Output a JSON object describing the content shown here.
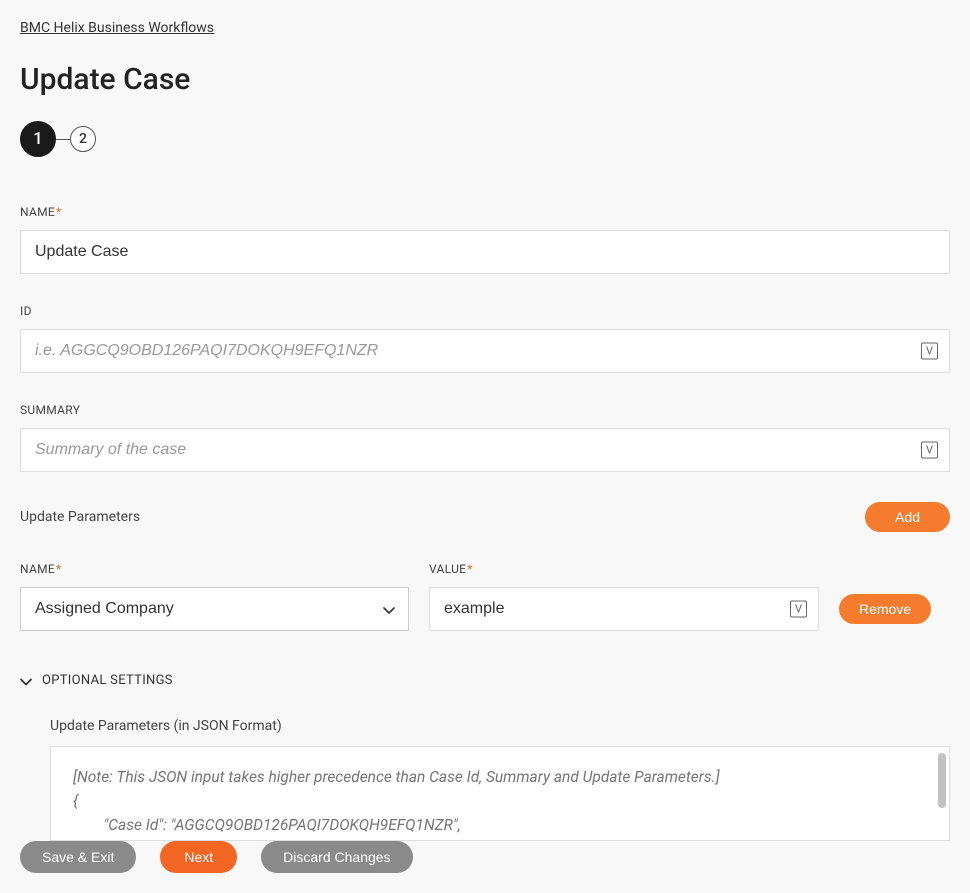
{
  "breadcrumb": "BMC Helix Business Workflows",
  "page_title": "Update Case",
  "stepper": {
    "steps": [
      "1",
      "2"
    ],
    "active": 0
  },
  "fields": {
    "name": {
      "label": "NAME",
      "required": true,
      "value": "Update Case"
    },
    "id": {
      "label": "ID",
      "required": false,
      "placeholder": "i.e. AGGCQ9OBD126PAQI7DOKQH9EFQ1NZR",
      "value": ""
    },
    "summary": {
      "label": "SUMMARY",
      "required": false,
      "placeholder": "Summary of the case",
      "value": ""
    }
  },
  "update_params": {
    "title": "Update Parameters",
    "add_label": "Add",
    "remove_label": "Remove",
    "row": {
      "name_label": "NAME",
      "name_value": "Assigned Company",
      "value_label": "VALUE",
      "value_value": "example"
    }
  },
  "optional": {
    "title": "OPTIONAL SETTINGS",
    "json_label": "Update Parameters (in JSON Format)",
    "json_placeholder": "[Note: This JSON input takes higher precedence than Case Id, Summary and Update Parameters.]\n{\n        \"Case Id\": \"AGGCQ9OBD126PAQI7DOKQH9EFQ1NZR\","
  },
  "footer": {
    "save": "Save & Exit",
    "next": "Next",
    "discard": "Discard Changes"
  },
  "icons": {
    "variable": "V"
  }
}
